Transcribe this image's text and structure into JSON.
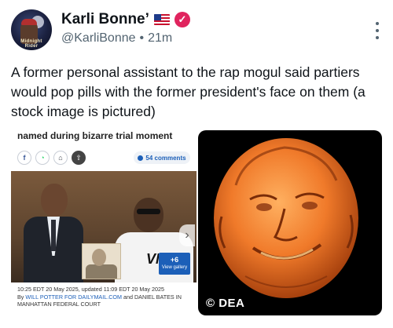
{
  "post": {
    "display_name": "Karli Bonne’",
    "handle": "@KarliBonne",
    "separator": "•",
    "time": "21m",
    "verified_mark": "✓",
    "avatar_text": "Midnight Rider",
    "text": "A former personal assistant to the rap mogul said partiers would pop pills with the former president's face on them (a stock image is pictured)"
  },
  "icons": {
    "more": "more-vertical-icon",
    "flag": "us-flag-icon",
    "verified": "verified-badge-icon"
  },
  "article_card": {
    "headline": "named during bizarre trial moment",
    "share_buttons": [
      "f",
      "◔",
      "⌂",
      "⇧"
    ],
    "comments_count": "54 comments",
    "shirt_text": "VNT",
    "gallery_count": "+6",
    "gallery_label": "View gallery",
    "nav_arrow": "›",
    "timestamp": "10:25 EDT 20 May 2025, updated 11:09 EDT 20 May 2025",
    "byline_prefix": "By",
    "byline_author1": "WILL POTTER FOR DAILYMAIL.COM",
    "byline_and": "and DANIEL BATES IN MANHATTAN FEDERAL COURT"
  },
  "pill_image": {
    "credit": "© DEA"
  },
  "colors": {
    "text": "#0f1419",
    "muted": "#536471",
    "verified": "#e0245e",
    "link": "#1c5fb8",
    "pill_orange": "#f07a2a"
  }
}
